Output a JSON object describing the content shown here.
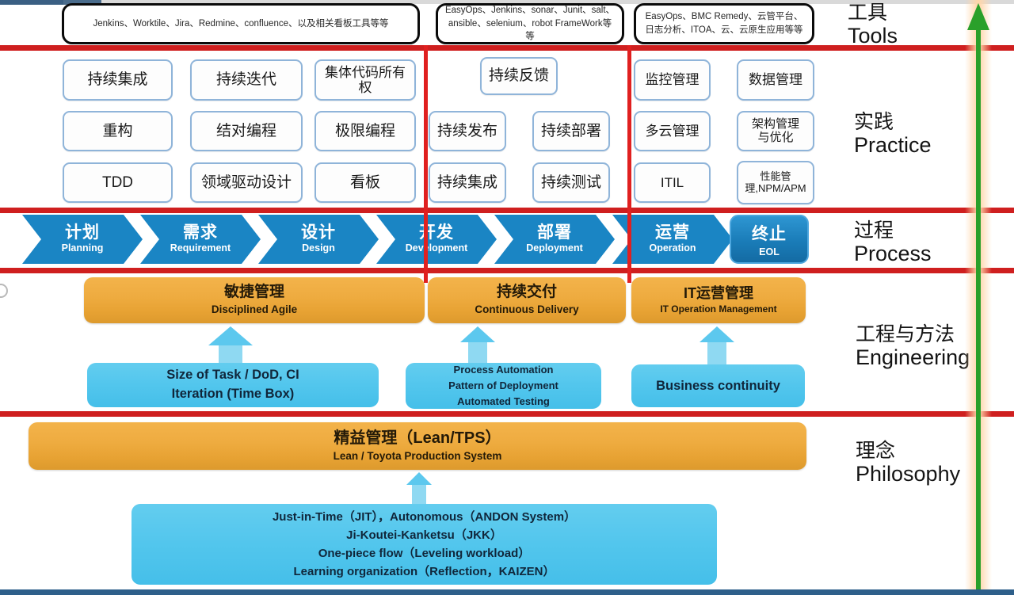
{
  "theme": {
    "red_divider": "#cf1f1f",
    "process_blue": "#1a85c4",
    "orange": "#eeab3f",
    "cyan": "#52c6ed",
    "practice_border": "#8fb4d9",
    "green_arrow": "#2aa02a"
  },
  "layers": {
    "tools": {
      "zh": "工具",
      "en": "Tools"
    },
    "practice": {
      "zh": "实践",
      "en": "Practice"
    },
    "process": {
      "zh": "过程",
      "en": "Process"
    },
    "engineering": {
      "zh": "工程与方法",
      "en": "Engineering"
    },
    "philosophy": {
      "zh": "理念",
      "en": "Philosophy"
    }
  },
  "tools": {
    "agile": "Jenkins、Worktile、Jira、Redmine、confluence、以及相关看板工具等等",
    "delivery": "EasyOps、Jenkins、sonar、Junit、salt、ansible、selenium、robot FrameWork等等",
    "itops": "EasyOps、BMC Remedy、云管平台、日志分析、ITOA、云、云原生应用等等"
  },
  "practice": {
    "agile": [
      "持续集成",
      "持续迭代",
      "集体代码所有权",
      "重构",
      "结对编程",
      "极限编程",
      "TDD",
      "领域驱动设计",
      "看板"
    ],
    "delivery": [
      "持续反馈",
      "持续发布",
      "持续部署",
      "持续集成",
      "持续测试"
    ],
    "itops": [
      "监控管理",
      "数据管理",
      "多云管理",
      "架构管理与优化",
      "ITIL",
      "性能管理,NPM/APM"
    ]
  },
  "process": {
    "stages": [
      {
        "zh": "计划",
        "en": "Planning"
      },
      {
        "zh": "需求",
        "en": "Requirement"
      },
      {
        "zh": "设计",
        "en": "Design"
      },
      {
        "zh": "开发",
        "en": "Development"
      },
      {
        "zh": "部署",
        "en": "Deployment"
      },
      {
        "zh": "运营",
        "en": "Operation"
      }
    ],
    "eol": {
      "zh": "终止",
      "en": "EOL"
    }
  },
  "engineering": {
    "bars": [
      {
        "zh": "敏捷管理",
        "en": "Disciplined Agile"
      },
      {
        "zh": "持续交付",
        "en": "Continuous Delivery"
      },
      {
        "zh": "IT运营管理",
        "en": "IT Operation Management"
      }
    ],
    "details": {
      "agile_l1": "Size of Task / DoD, CI",
      "agile_l2": "Iteration (Time Box)",
      "delivery_l1": "Process Automation",
      "delivery_l2": "Pattern of Deployment",
      "delivery_l3": "Automated Testing",
      "itops_l1": "Business continuity"
    }
  },
  "philosophy": {
    "bar": {
      "zh": "精益管理（Lean/TPS）",
      "en": "Lean / Toyota Production System"
    },
    "details": [
      "Just-in-Time（JIT），Autonomous（ANDON System）",
      "Ji-Koutei-Kanketsu（JKK）",
      "One-piece flow（Leveling workload）",
      "Learning organization（Reflection，KAIZEN）"
    ]
  }
}
